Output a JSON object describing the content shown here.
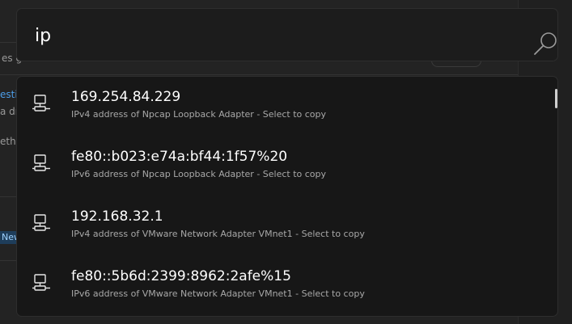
{
  "search": {
    "query": "ip"
  },
  "results": [
    {
      "title": "169.254.84.229",
      "subtitle": "IPv4 address of Npcap Loopback Adapter - Select to copy",
      "icon": "network-computer-icon"
    },
    {
      "title": "fe80::b023:e74a:bf44:1f57%20",
      "subtitle": "IPv6 address of Npcap Loopback Adapter - Select to copy",
      "icon": "network-computer-icon"
    },
    {
      "title": "192.168.32.1",
      "subtitle": "IPv4 address of VMware Network Adapter VMnet1 - Select to copy",
      "icon": "network-computer-icon"
    },
    {
      "title": "fe80::5b6d:2399:8962:2afe%15",
      "subtitle": "IPv6 address of VMware Network Adapter VMnet1 - Select to copy",
      "icon": "network-computer-icon"
    }
  ],
  "background": {
    "fragments": [
      "es g",
      "esti",
      "a dr",
      "ethi",
      "New"
    ]
  }
}
